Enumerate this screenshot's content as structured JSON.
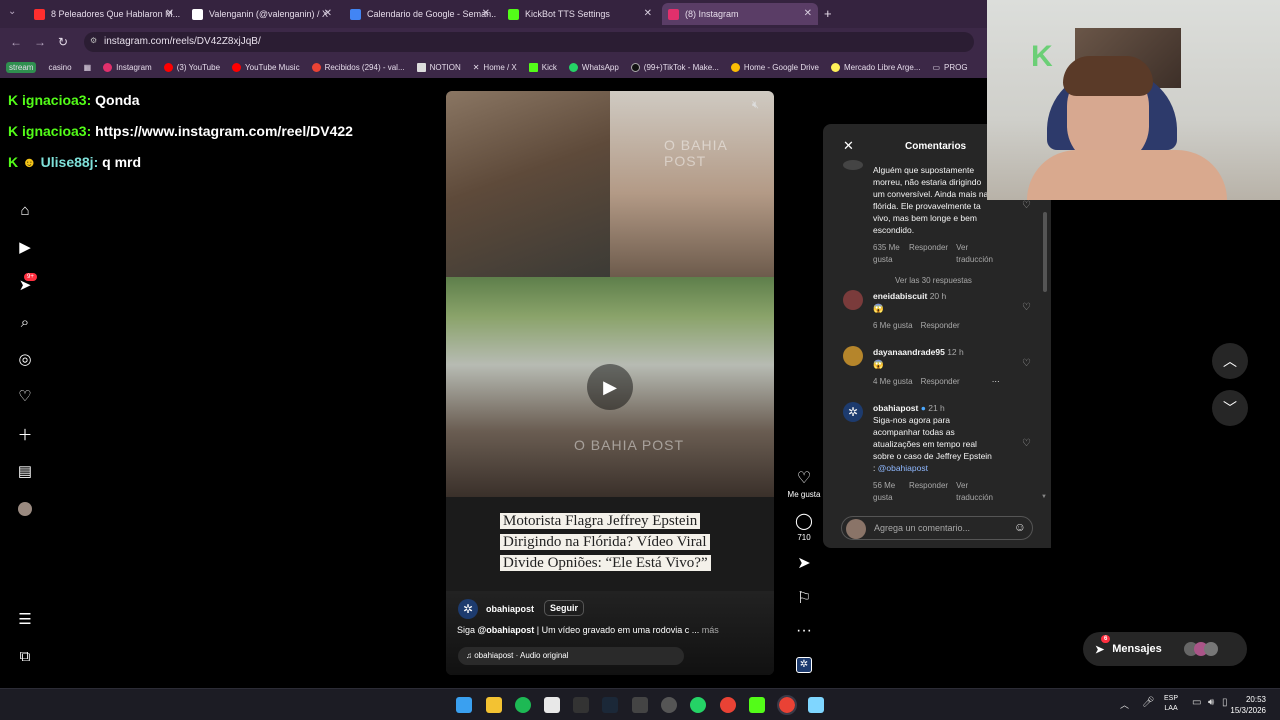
{
  "browser": {
    "tabs": [
      {
        "title": "8 Peleadores Que Hablaron M...",
        "color": "#ff2e2e"
      },
      {
        "title": "Valenganin (@valenganin) / X",
        "color": "#ffffff"
      },
      {
        "title": "Calendario de Google - Seman...",
        "color": "#4285f4"
      },
      {
        "title": "KickBot TTS Settings",
        "color": "#53fc18"
      },
      {
        "title": "(8) Instagram",
        "color": "#e1306c"
      }
    ],
    "new_tab": "+",
    "url": "instagram.com/reels/DV42Z8xjJqB/",
    "bookmarks": [
      {
        "label": "stream",
        "color": "#2f8f4f"
      },
      {
        "label": "casino",
        "color": "#888888"
      },
      {
        "label": "Instagram",
        "color": "#e1306c"
      },
      {
        "label": "(3) YouTube",
        "color": "#ff0000"
      },
      {
        "label": "YouTube Music",
        "color": "#ff0000"
      },
      {
        "label": "Recibidos (294) - val...",
        "color": "#ea4335"
      },
      {
        "label": "NOTION",
        "color": "#dddddd"
      },
      {
        "label": "Home / X",
        "color": "#ffffff"
      },
      {
        "label": "Kick",
        "color": "#53fc18"
      },
      {
        "label": "WhatsApp",
        "color": "#25d366"
      },
      {
        "label": "(99+)TikTok - Make...",
        "color": "#111111"
      },
      {
        "label": "Home - Google Drive",
        "color": "#fbbc04"
      },
      {
        "label": "Mercado Libre Arge...",
        "color": "#fff159"
      },
      {
        "label": "PROG",
        "color": "#bbbbbb"
      }
    ]
  },
  "chat": [
    {
      "user": "ignacioa3:",
      "message": "Qonda"
    },
    {
      "user": "ignacioa3:",
      "message": "https://www.instagram.com/reel/DV422"
    },
    {
      "user": "Ulise88j:",
      "message": "q mrd"
    }
  ],
  "sidebar": {
    "notification_badge": "9+"
  },
  "reel": {
    "watermark": "O BAHIA POST",
    "headline": "Motorista Flagra Jeffrey Epstein Dirigindo na Flórida? Vídeo Viral Divide Opniões: “Ele Está Vivo?”",
    "account": "obahiapost",
    "follow": "Seguir",
    "caption_prefix": "Siga ",
    "caption_mention": "@obahiapost",
    "caption_text": " | Um vídeo gravado em uma rodovia c ...",
    "caption_more": "más",
    "audio": "obahiapost · Audio original",
    "actions": {
      "like_label": "Me gusta",
      "comment_count": "710"
    }
  },
  "comments": {
    "title": "Comentarios",
    "items": [
      {
        "text": "Alguém que supostamente morreu, não estaria dirigindo um conversível. Ainda mais na flórida. Ele provavelmente ta vivo, mas bem longe e bem escondido.",
        "likes": "635 Me gusta",
        "reply": "Responder",
        "translate": "Ver traducción",
        "replies": "Ver las 30 respuestas"
      },
      {
        "user": "eneidabiscuit",
        "time": "20 h",
        "text": "😱",
        "likes": "6 Me gusta",
        "reply": "Responder",
        "avatar_color": "#7a3b3b"
      },
      {
        "user": "dayanaandrade95",
        "time": "12 h",
        "text": "😱",
        "likes": "4 Me gusta",
        "reply": "Responder",
        "more": "···",
        "avatar_color": "#b5852b"
      },
      {
        "user": "obahiapost",
        "time": "21 h",
        "text": "Siga-nos agora para acompanhar todas as atualizações em tempo real sobre o caso de Jeffrey Epstein : ",
        "mention": "@obahiapost",
        "likes": "56 Me gusta",
        "reply": "Responder",
        "translate": "Ver traducción",
        "avatar_color": "#1d3b6e"
      }
    ],
    "input_placeholder": "Agrega un comentario..."
  },
  "messages": {
    "label": "Mensajes",
    "badge": "6"
  },
  "taskbar": {
    "lang": "ESP",
    "lang_sub": "LAA",
    "time": "20:53",
    "date": "15/3/2026"
  }
}
